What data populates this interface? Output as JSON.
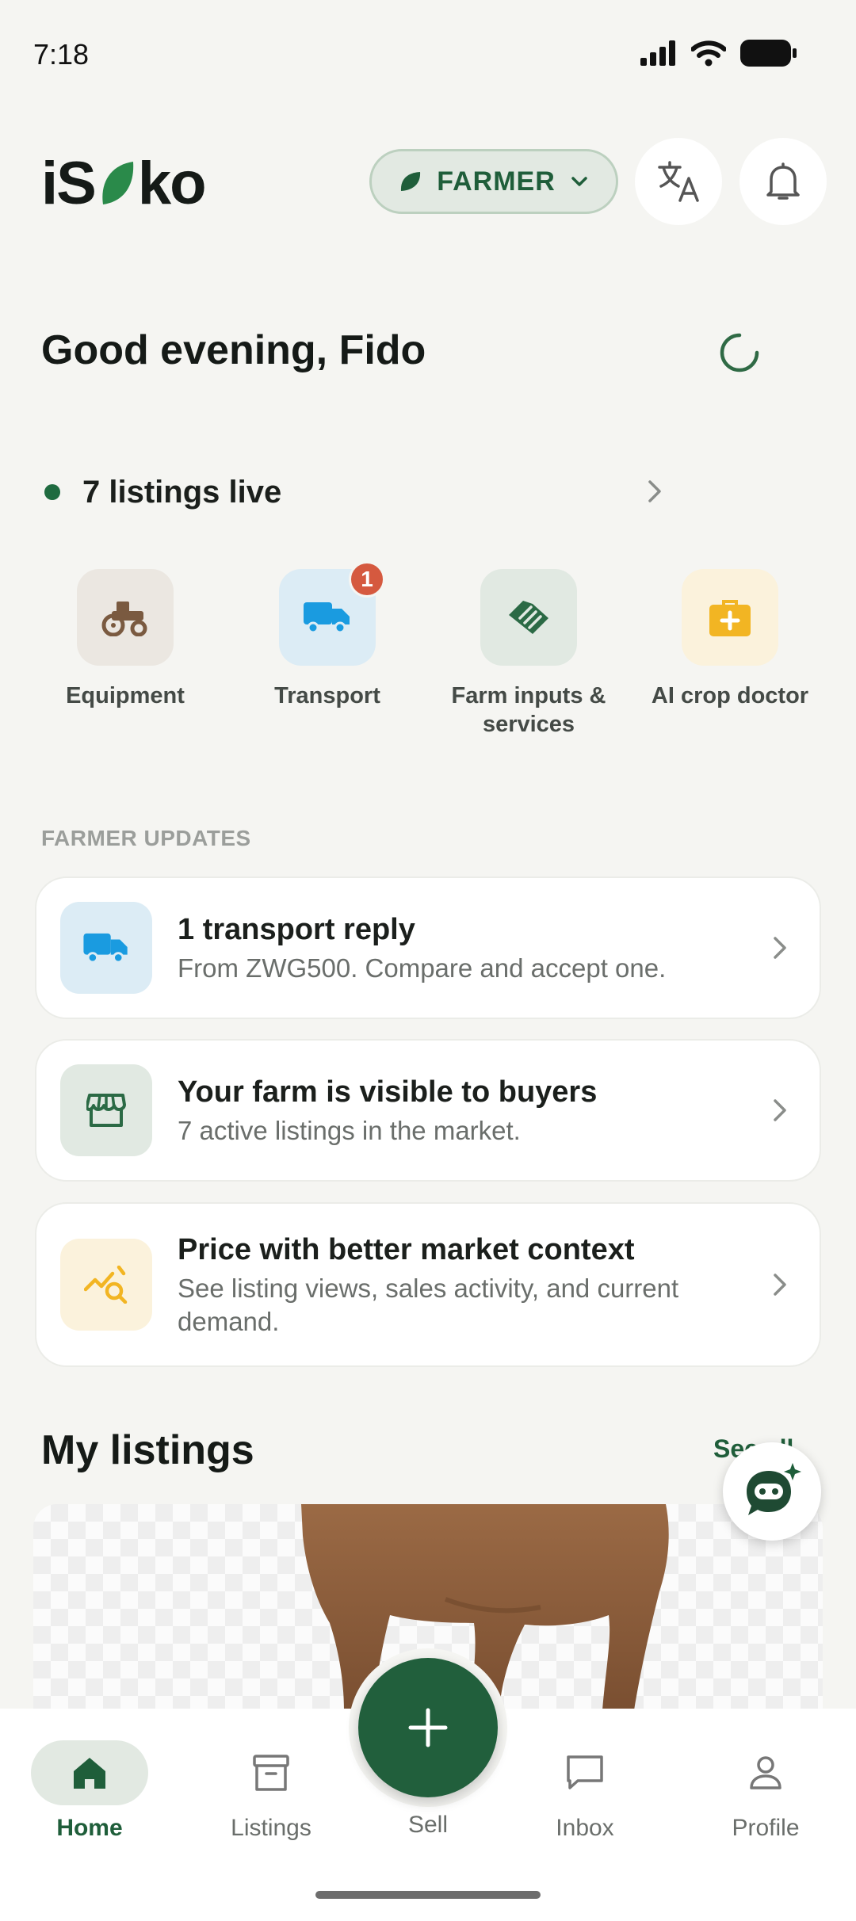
{
  "status_bar": {
    "time": "7:18"
  },
  "header": {
    "logo_left": "iS",
    "logo_right": "ko",
    "role": "FARMER"
  },
  "greeting": "Good evening, Fido",
  "listings_live": "7 listings live",
  "quick_actions": [
    {
      "label": "Equipment",
      "icon": "tractor-icon",
      "color": "#ebe7e1"
    },
    {
      "label": "Transport",
      "icon": "truck-icon",
      "color": "#dcecf5",
      "badge": "1"
    },
    {
      "label": "Farm inputs & services",
      "icon": "handshake-icon",
      "color": "#e1e9e2"
    },
    {
      "label": "AI crop doctor",
      "icon": "first-aid-kit-icon",
      "color": "#fbf2dc"
    }
  ],
  "updates": {
    "heading": "FARMER UPDATES",
    "cards": [
      {
        "title": "1 transport reply",
        "subtitle": "From ZWG500. Compare and accept one.",
        "icon": "truck-icon"
      },
      {
        "title": "Your farm is visible to buyers",
        "subtitle": "7 active listings in the market.",
        "icon": "storefront-icon"
      },
      {
        "title": "Price with better market context",
        "subtitle": "See listing views, sales activity, and current demand.",
        "icon": "chart-search-icon"
      }
    ]
  },
  "my_listings": {
    "title": "My listings",
    "see_all": "See all"
  },
  "nav": {
    "home": "Home",
    "listings": "Listings",
    "sell": "Sell",
    "inbox": "Inbox",
    "profile": "Profile"
  },
  "colors": {
    "brand_green": "#1f5e3a",
    "background": "#f5f5f2",
    "badge": "#d5593f",
    "transport_blue": "#1a9be0",
    "insight_yellow": "#f2b523"
  }
}
